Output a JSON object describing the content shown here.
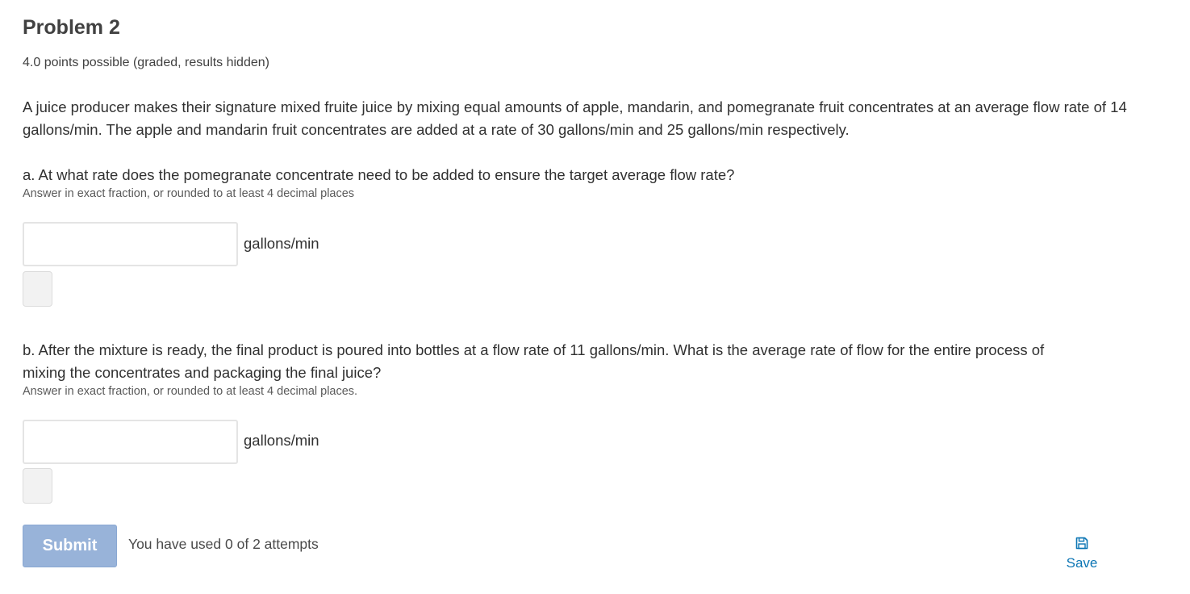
{
  "problem": {
    "title": "Problem 2",
    "points": "4.0 points possible (graded, results hidden)",
    "prompt": "A juice producer makes their signature mixed fruite juice by mixing equal amounts of apple, mandarin, and pomegranate fruit concentrates at an average flow rate of 14 gallons/min. The apple and mandarin fruit concentrates are added at a rate of 30 gallons/min and 25 gallons/min respectively."
  },
  "part_a": {
    "question": "a. At what rate does the pomegranate concentrate need to be added to ensure the target average flow rate?",
    "hint": "Answer in exact fraction, or rounded to at least 4 decimal places",
    "input_value": "",
    "unit": "gallons/min"
  },
  "part_b": {
    "question": "b. After the mixture is ready, the final product is poured into bottles at a flow rate of 11 gallons/min. What is the average rate of flow for the entire process of mixing the concentrates and packaging the final juice?",
    "hint": "Answer in exact fraction, or rounded to at least 4 decimal places.",
    "input_value": "",
    "unit": "gallons/min"
  },
  "actions": {
    "submit_label": "Submit",
    "attempts_text": "You have used 0 of 2 attempts",
    "save_label": "Save",
    "save_icon": "floppy-disk-icon"
  },
  "colors": {
    "submit_bg": "#98b3d9",
    "link": "#0b75b4",
    "text": "#313131"
  }
}
